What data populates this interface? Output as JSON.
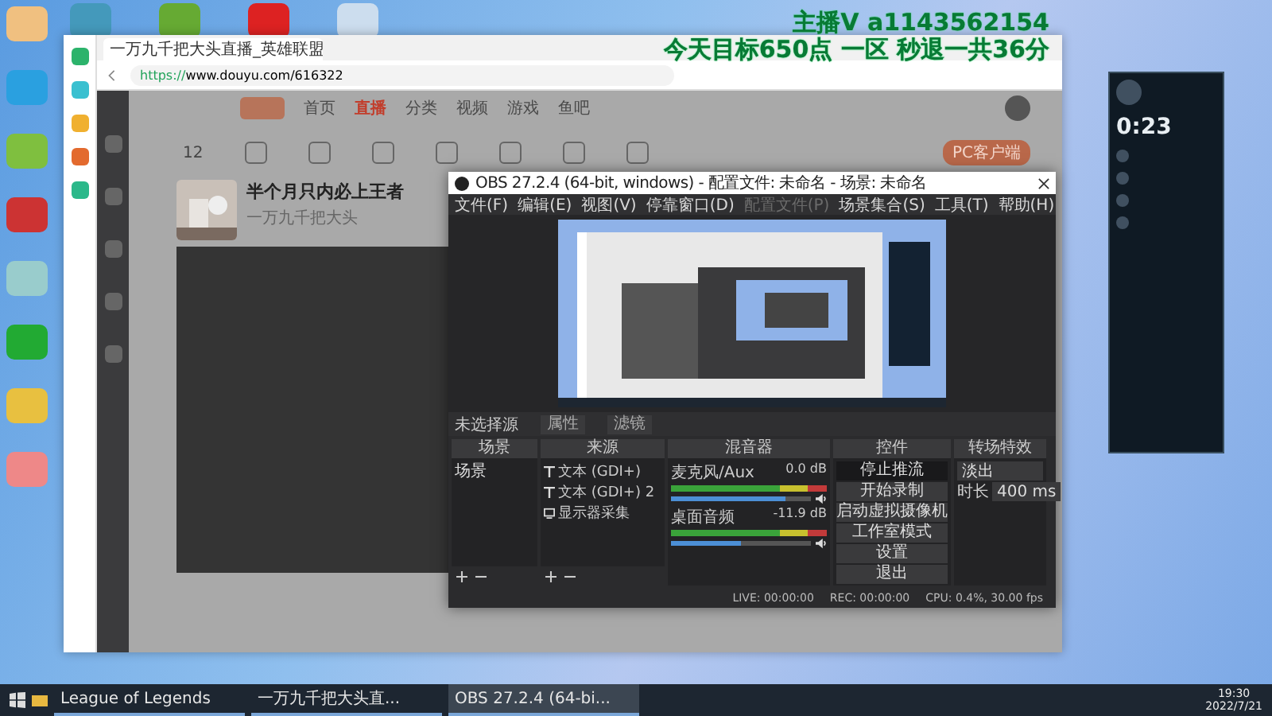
{
  "overlay": {
    "lines": [
      "主播V a1143562154",
      "今天目标650点 一区 秒退一共36分"
    ]
  },
  "browser": {
    "tab_title": "一万九千把大头直播_英雄联盟",
    "url_scheme": "https://",
    "url_rest": "www.douyu.com/616322",
    "nav": [
      {
        "label": "首页",
        "selected": false
      },
      {
        "label": "直播",
        "selected": true
      },
      {
        "label": "分类",
        "selected": false
      },
      {
        "label": "视频",
        "selected": false
      },
      {
        "label": "游戏",
        "selected": false
      },
      {
        "label": "鱼吧",
        "selected": false
      }
    ],
    "stat_count": "12",
    "client_button": "PC客户端",
    "stream_title": "半个月只内必上王者",
    "streamer": "一万九千把大头"
  },
  "obs": {
    "title": "OBS 27.2.4 (64-bit, windows) - 配置文件: 未命名 - 场景: 未命名",
    "menu": [
      {
        "label": "文件(F)",
        "disabled": false
      },
      {
        "label": "编辑(E)",
        "disabled": false
      },
      {
        "label": "视图(V)",
        "disabled": false
      },
      {
        "label": "停靠窗口(D)",
        "disabled": false
      },
      {
        "label": "配置文件(P)",
        "disabled": true
      },
      {
        "label": "场景集合(S)",
        "disabled": false
      },
      {
        "label": "工具(T)",
        "disabled": false
      },
      {
        "label": "帮助(H)",
        "disabled": false
      }
    ],
    "no_source": "未选择源",
    "properties_button": "属性",
    "filters_button": "滤镜",
    "docks": [
      "场景",
      "来源",
      "混音器",
      "控件",
      "转场特效"
    ],
    "scenes": [
      "场景"
    ],
    "sources": [
      {
        "kind": "text",
        "name": "文本 (GDI+)"
      },
      {
        "kind": "text",
        "name": "文本 (GDI+) 2"
      },
      {
        "kind": "display",
        "name": "显示器采集"
      }
    ],
    "mixer": [
      {
        "name": "麦克风/Aux",
        "reading": "0.0 dB",
        "level": 0.82
      },
      {
        "name": "桌面音频",
        "reading": "-11.9 dB",
        "level": 0.5
      }
    ],
    "controls": [
      {
        "label": "停止推流",
        "active": true
      },
      {
        "label": "开始录制",
        "active": false
      },
      {
        "label": "启动虚拟摄像机",
        "active": false
      },
      {
        "label": "工作室模式",
        "active": false
      },
      {
        "label": "设置",
        "active": false
      },
      {
        "label": "退出",
        "active": false
      }
    ],
    "transition": {
      "value": "淡出",
      "duration_label": "时长",
      "duration": "400 ms"
    },
    "status": [
      "LIVE: 00:00:00",
      "REC: 00:00:00",
      "CPU: 0.4%, 30.00 fps"
    ]
  },
  "client": {
    "timer": "0:23"
  },
  "taskbar": {
    "items": [
      {
        "label": "League of Legends",
        "selected": false
      },
      {
        "label": "一万九千把大头直...",
        "selected": false
      },
      {
        "label": "OBS 27.2.4 (64-bi...",
        "selected": true
      }
    ],
    "time": "19:30",
    "date": "2022/7/21"
  }
}
